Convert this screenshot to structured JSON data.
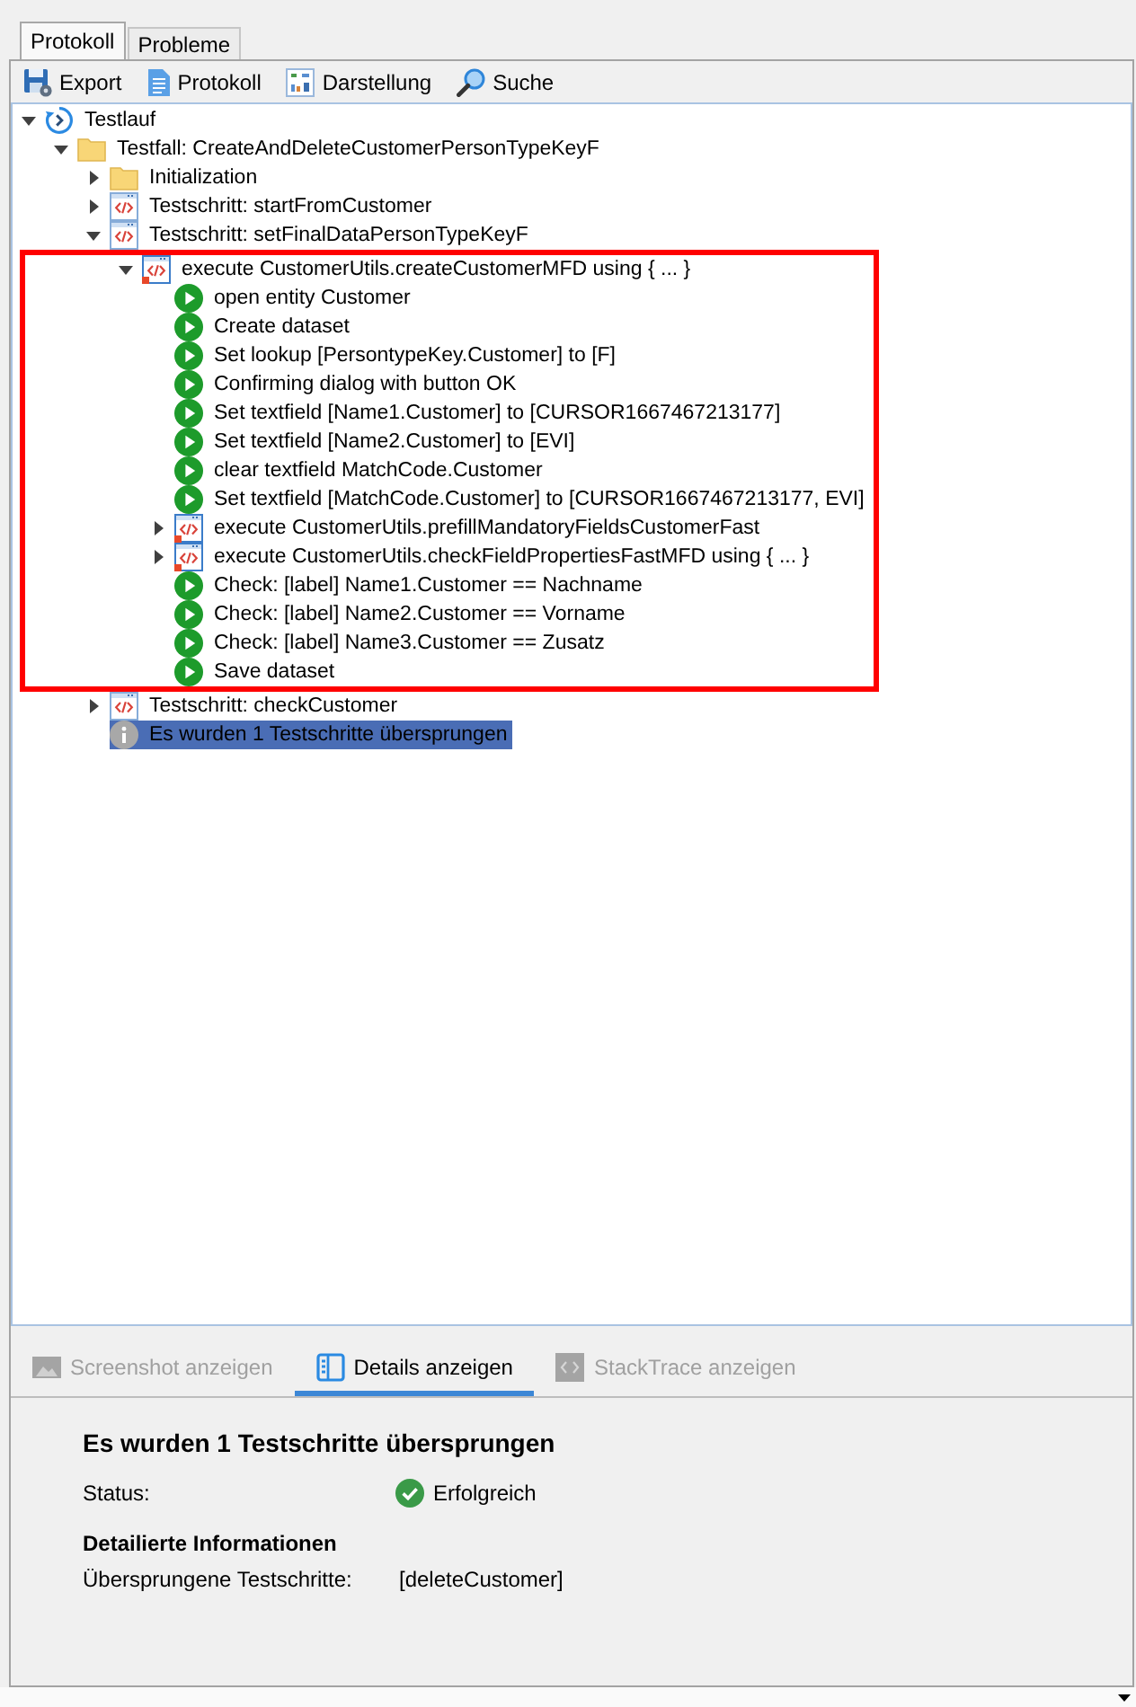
{
  "tabs": [
    {
      "label": "Protokoll",
      "selected": true
    },
    {
      "label": "Probleme",
      "selected": false
    }
  ],
  "toolbar": [
    {
      "label": "Export",
      "kind": "export"
    },
    {
      "label": "Protokoll",
      "kind": "log"
    },
    {
      "label": "Darstellung",
      "kind": "view"
    },
    {
      "label": "Suche",
      "kind": "search"
    }
  ],
  "tree": [
    {
      "label": "Testlauf",
      "kind": "run",
      "expanded": true,
      "selected": false,
      "highlighted": false,
      "children": [
        {
          "label": "Testfall: CreateAndDeleteCustomerPersonTypeKeyF",
          "kind": "folder",
          "expanded": true,
          "selected": false,
          "highlighted": false,
          "children": [
            {
              "label": "Initialization",
              "kind": "folder",
              "expanded": false,
              "selected": false,
              "highlighted": false
            },
            {
              "label": "Testschritt: startFromCustomer",
              "kind": "step",
              "expanded": false,
              "selected": false,
              "highlighted": false
            },
            {
              "label": "Testschritt: setFinalDataPersonTypeKeyF",
              "kind": "step",
              "expanded": true,
              "selected": false,
              "highlighted": false,
              "children": [
                {
                  "label": "execute CustomerUtils.createCustomerMFD using { ... }",
                  "kind": "script",
                  "expanded": true,
                  "selected": false,
                  "highlighted": true,
                  "children": [
                    {
                      "label": "open entity Customer",
                      "kind": "action",
                      "selected": false,
                      "highlighted": false
                    },
                    {
                      "label": "Create dataset",
                      "kind": "action",
                      "selected": false,
                      "highlighted": false
                    },
                    {
                      "label": "Set lookup [PersontypeKey.Customer] to [F]",
                      "kind": "action",
                      "selected": false,
                      "highlighted": false
                    },
                    {
                      "label": "Confirming dialog with button OK",
                      "kind": "action",
                      "selected": false,
                      "highlighted": false
                    },
                    {
                      "label": "Set textfield [Name1.Customer] to [CURSOR1667467213177]",
                      "kind": "action",
                      "selected": false,
                      "highlighted": false
                    },
                    {
                      "label": "Set textfield [Name2.Customer] to [EVI]",
                      "kind": "action",
                      "selected": false,
                      "highlighted": false
                    },
                    {
                      "label": "clear textfield MatchCode.Customer",
                      "kind": "action",
                      "selected": false,
                      "highlighted": false
                    },
                    {
                      "label": "Set textfield [MatchCode.Customer] to [CURSOR1667467213177, EVI]",
                      "kind": "action",
                      "selected": false,
                      "highlighted": false
                    },
                    {
                      "label": "execute CustomerUtils.prefillMandatoryFieldsCustomerFast",
                      "kind": "script",
                      "expanded": false,
                      "selected": false,
                      "highlighted": false
                    },
                    {
                      "label": "execute CustomerUtils.checkFieldPropertiesFastMFD using { ... }",
                      "kind": "script",
                      "expanded": false,
                      "selected": false,
                      "highlighted": false
                    },
                    {
                      "label": "Check: [label] Name1.Customer == Nachname",
                      "kind": "action",
                      "selected": false,
                      "highlighted": false
                    },
                    {
                      "label": "Check: [label] Name2.Customer == Vorname",
                      "kind": "action",
                      "selected": false,
                      "highlighted": false
                    },
                    {
                      "label": "Check: [label] Name3.Customer == Zusatz",
                      "kind": "action",
                      "selected": false,
                      "highlighted": false
                    },
                    {
                      "label": "Save dataset",
                      "kind": "action",
                      "selected": false,
                      "highlighted": false
                    }
                  ]
                }
              ]
            },
            {
              "label": "Testschritt: checkCustomer",
              "kind": "step",
              "expanded": false,
              "selected": false,
              "highlighted": false
            },
            {
              "label": "Es wurden 1 Testschritte übersprungen",
              "kind": "info",
              "selected": true,
              "highlighted": false
            }
          ]
        }
      ]
    }
  ],
  "detail_tabs": [
    {
      "label": "Screenshot anzeigen",
      "kind": "screenshot",
      "selected": false,
      "disabled": true
    },
    {
      "label": "Details anzeigen",
      "kind": "details",
      "selected": true,
      "disabled": false
    },
    {
      "label": "StackTrace anzeigen",
      "kind": "stacktrace",
      "selected": false,
      "disabled": true
    }
  ],
  "details": {
    "title": "Es wurden 1 Testschritte übersprungen",
    "status": {
      "label": "Status:",
      "value": "Erfolgreich",
      "kind": "success"
    },
    "section_title": "Detailierte Informationen",
    "rows": [
      {
        "label": "Übersprungene Testschritte:",
        "value": "[deleteCustomer]"
      }
    ]
  }
}
